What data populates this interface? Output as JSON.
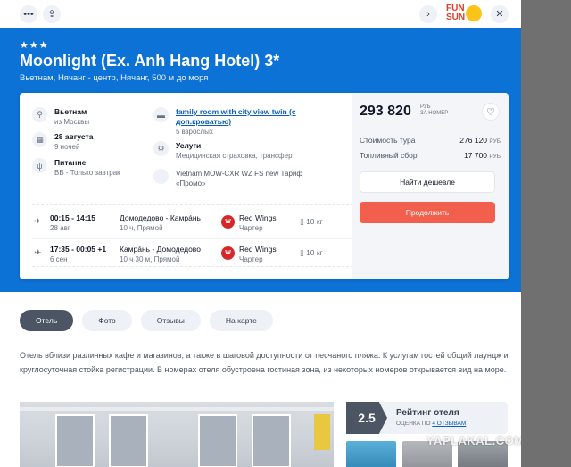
{
  "topbar": {
    "menu_icon": "more-dots-icon",
    "share_icon": "share-icon",
    "next_icon": "chevron-right-icon",
    "close_icon": "close-icon",
    "logo_line1": "FUN",
    "logo_line2": "SUN"
  },
  "hotel": {
    "stars": "★★★",
    "name": "Moonlight (Ex. Anh Hang Hotel) 3*",
    "location": "Вьетнам, Нячанг - центр, Нячанг, 500 м до моря"
  },
  "details": {
    "destination_title": "Вьетнам",
    "destination_sub": "из Москвы",
    "date_title": "28 августа",
    "date_sub": "9 ночей",
    "meal_title": "Питание",
    "meal_sub": "BB - Только завтрак",
    "room_link": "family room with city view twin (с доп.кроватью)",
    "room_sub": "5 взрослых",
    "services_title": "Услуги",
    "services_sub": "Медицинская страховка, трансфер",
    "tariff_note": "Vietnam MOW-CXR WZ FS new Тариф «Промо»"
  },
  "flights": [
    {
      "times": "00:15 - 14:15",
      "date": "28 авг",
      "route": "Домодедово - Камрáнь",
      "duration": "10 ч, Прямой",
      "airline": "Red Wings",
      "type": "Чартер",
      "baggage": "10 кг"
    },
    {
      "times": "17:35 - 00:05 +1",
      "date": "6 сен",
      "route": "Камрáнь - Домодедово",
      "duration": "10 ч 30 м, Прямой",
      "airline": "Red Wings",
      "type": "Чартер",
      "baggage": "10 кг"
    }
  ],
  "price": {
    "total": "293 820",
    "currency": "РУБ",
    "per": "ЗА НОМЕР",
    "tour_label": "Стоимость тура",
    "tour_value": "276 120",
    "fuel_label": "Топливный сбор",
    "fuel_value": "17 700",
    "rub": "РУБ",
    "cheaper_button": "Найти дешевле",
    "continue_button": "Продолжить"
  },
  "tabs": [
    "Отель",
    "Фото",
    "Отзывы",
    "На карте"
  ],
  "description": "Отель вблизи различных кафе и магазинов, а также в шаговой доступности от песчаного пляжа. К услугам гостей общий лаундж и круглосуточная стойка регистрации. В номерах отеля обустроена гостиная зона, из некоторых номеров открывается вид на море.",
  "rating": {
    "score": "2.5",
    "title": "Рейтинг отеля",
    "sub_prefix": "ОЦЕНКА ПО",
    "sub_link": "4 ОТЗЫВАМ"
  },
  "watermark": "YAPLAKAL.COM",
  "colors": {
    "hero": "#0c72d6",
    "accent": "#f25f4c",
    "link": "#0c5fb8"
  }
}
